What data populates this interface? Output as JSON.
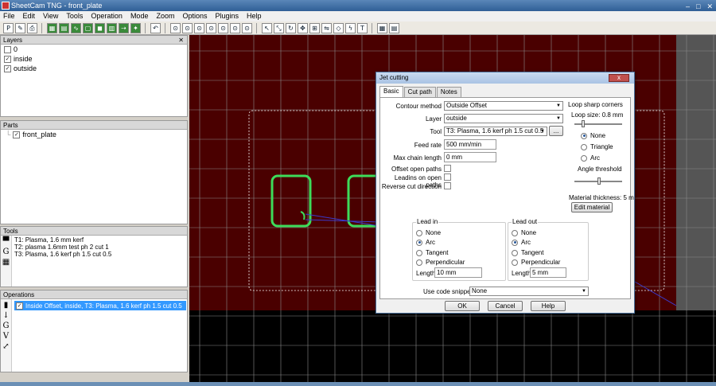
{
  "window": {
    "title": "SheetCam TNG - front_plate"
  },
  "menu": [
    "File",
    "Edit",
    "View",
    "Tools",
    "Operation",
    "Mode",
    "Zoom",
    "Options",
    "Plugins",
    "Help"
  ],
  "layers": {
    "title": "Layers",
    "items": [
      {
        "label": "0",
        "checked": false
      },
      {
        "label": "inside",
        "checked": true
      },
      {
        "label": "outside",
        "checked": true
      }
    ]
  },
  "parts": {
    "title": "Parts",
    "items": [
      {
        "label": "front_plate",
        "checked": true
      }
    ]
  },
  "tools": {
    "title": "Tools",
    "items": [
      "T1: Plasma, 1.6 mm kerf",
      "T2: plasma 1.6mm test ph 2 cut 1",
      "T3: Plasma, 1.6 kerf ph 1.5 cut 0.5"
    ]
  },
  "operations": {
    "title": "Operations",
    "items": [
      {
        "label": "Inside Offset, inside, T3: Plasma, 1.6 kerf ph 1.5 cut 0.5",
        "checked": true,
        "selected": true
      }
    ]
  },
  "dialog": {
    "title": "Jet cutting",
    "close": "x",
    "tabs": [
      "Basic",
      "Cut path",
      "Notes"
    ],
    "contour_method_label": "Contour method",
    "contour_method": "Outside Offset",
    "layer_label": "Layer",
    "layer": "outside",
    "tool_label": "Tool",
    "tool": "T3: Plasma, 1.6 kerf ph 1.5 cut 0.5",
    "tool_more": "...",
    "feed_rate_label": "Feed rate",
    "feed_rate": "500 mm/min",
    "max_chain_label": "Max chain length",
    "max_chain": "0 mm",
    "offset_open_label": "Offset open paths",
    "leadins_open_label": "Leadins on open paths",
    "reverse_label": "Reverse cut direction",
    "loop": {
      "title": "Loop sharp corners",
      "size_label": "Loop size: 0.8 mm",
      "options": [
        "None",
        "Triangle",
        "Arc"
      ],
      "selected": "None",
      "angle_label": "Angle threshold",
      "size_level": 0.15,
      "angle_level": 0.5
    },
    "material_thickness": "Material thickness: 5 m",
    "edit_material": "Edit material",
    "lead_in": {
      "title": "Lead in",
      "options": [
        "None",
        "Arc",
        "Tangent",
        "Perpendicular"
      ],
      "selected": "Arc",
      "length_label": "Length",
      "length": "10 mm"
    },
    "lead_out": {
      "title": "Lead out",
      "options": [
        "None",
        "Arc",
        "Tangent",
        "Perpendicular"
      ],
      "selected": "Arc",
      "length_label": "Length",
      "length": "5 mm"
    },
    "code_snippet_label": "Use code snippet",
    "code_snippet": "None",
    "ok": "OK",
    "cancel": "Cancel",
    "help": "Help"
  },
  "colors": {
    "sheet": "#4a0000",
    "grid": "#8a8a8a",
    "path": "#3ddc5a",
    "selection": "#3399ff"
  }
}
